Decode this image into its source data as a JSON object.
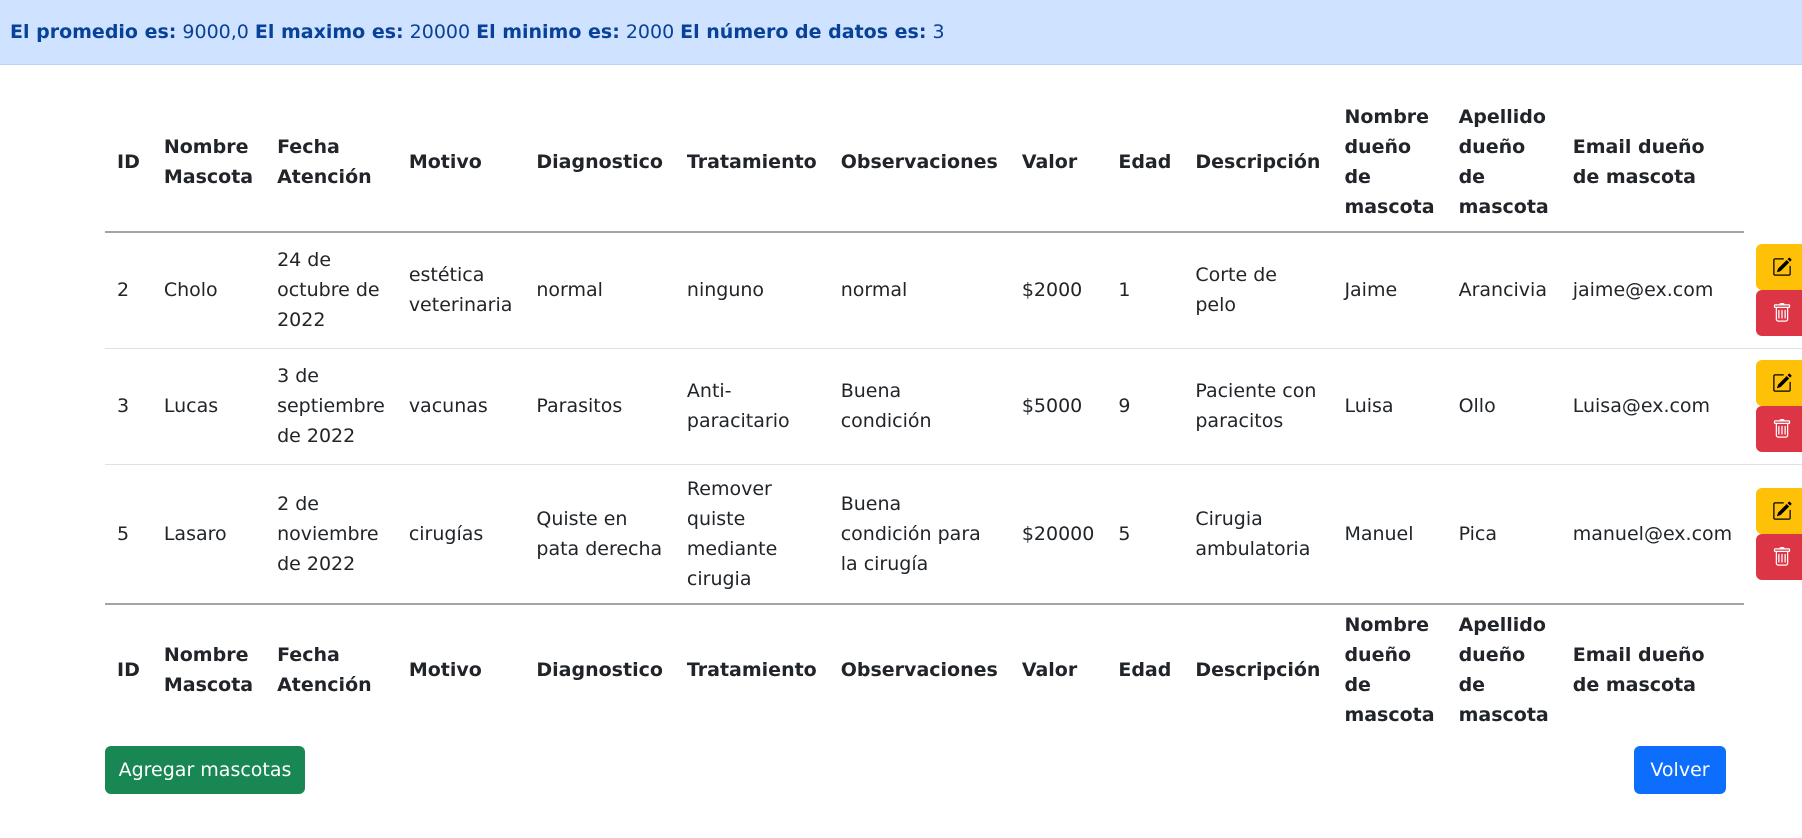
{
  "stats": {
    "promedio_label": "El promedio es:",
    "promedio_value": "9000,0",
    "maximo_label": "El maximo es:",
    "maximo_value": "20000",
    "minimo_label": "El minimo es:",
    "minimo_value": "2000",
    "numero_label": "El número de datos es:",
    "numero_value": "3"
  },
  "table": {
    "headers": [
      "ID",
      "Nombre Mascota",
      "Fecha Atención",
      "Motivo",
      "Diagnostico",
      "Tratamiento",
      "Observaciones",
      "Valor",
      "Edad",
      "Descripción",
      "Nombre dueño de mascota",
      "Apellido dueño de mascota",
      "Email dueño de mascota"
    ],
    "rows": [
      [
        "2",
        "Cholo",
        "24 de octubre de 2022",
        "estética veterinaria",
        "normal",
        "ninguno",
        "normal",
        "$2000",
        "1",
        "Corte de pelo",
        "Jaime",
        "Arancivia",
        "jaime@ex.com"
      ],
      [
        "3",
        "Lucas",
        "3 de septiembre de 2022",
        "vacunas",
        "Parasitos",
        "Anti-paracitario",
        "Buena condición",
        "$5000",
        "9",
        "Paciente con paracitos",
        "Luisa",
        "Ollo",
        "Luisa@ex.com"
      ],
      [
        "5",
        "Lasaro",
        "2 de noviembre de 2022",
        "cirugías",
        "Quiste en pata derecha",
        "Remover quiste mediante cirugia",
        "Buena condición para la cirugía",
        "$20000",
        "5",
        "Cirugia ambulatoria",
        "Manuel",
        "Pica",
        "manuel@ex.com"
      ]
    ]
  },
  "buttons": {
    "add_label": "Agregar mascotas",
    "back_label": "Volver"
  },
  "colors": {
    "stats_bg": "#cfe2ff",
    "stats_text": "#084298",
    "edit": "#ffc107",
    "delete": "#dc3545",
    "add": "#198754",
    "back": "#0d6efd"
  },
  "icons": {
    "edit": "pencil-square-icon",
    "delete": "trash-icon"
  }
}
